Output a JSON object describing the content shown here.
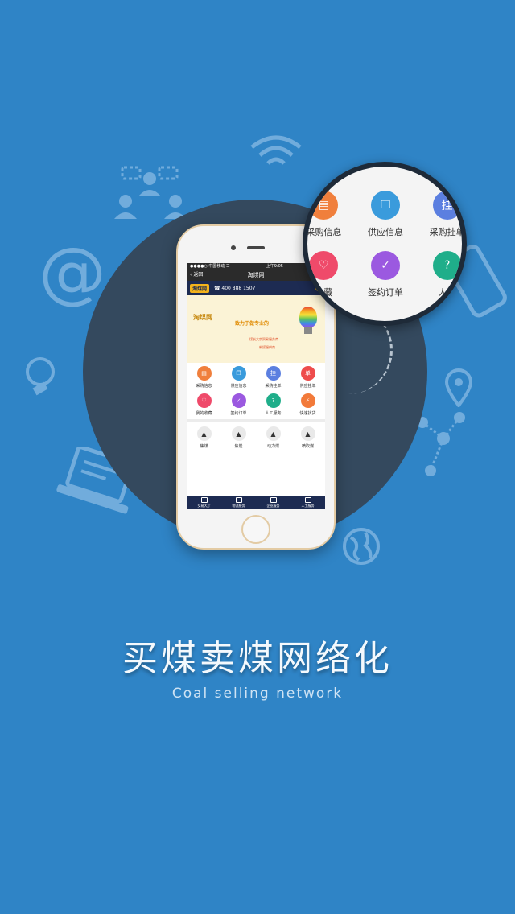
{
  "colors": {
    "background": "#2f84c6",
    "circle": "#34495e",
    "navy": "#1d2b52"
  },
  "decor_icons": [
    "people-icon",
    "wifi-icon",
    "at-icon",
    "lightbulb-icon",
    "laptop-icon",
    "phone-icon",
    "location-icon",
    "network-icon",
    "globe-icon"
  ],
  "phone": {
    "status_left": "●●●●○ 中国移动 ☰",
    "status_time": "上午9:05",
    "nav_back": "返回",
    "nav_title": "淘煤网",
    "brand_logo": "淘煤网",
    "hotline": "☎ 400 888 1507",
    "banner": {
      "logo": "淘煤网",
      "slogan": "致力于做专业的",
      "line1": "煤炭大宗贸易服务商",
      "line2": "新媒服供商"
    },
    "grid": [
      {
        "label": "采购信息",
        "glyph": "▤",
        "color": "#f07f3c",
        "icon": "document-icon"
      },
      {
        "label": "供应信息",
        "glyph": "❐",
        "color": "#3a9bdc",
        "icon": "copy-icon"
      },
      {
        "label": "采购挂单",
        "glyph": "挂",
        "color": "#5b7fe0",
        "icon": "hang-order-icon"
      },
      {
        "label": "供应挂单",
        "glyph": "单",
        "color": "#ee4c4c",
        "icon": "order-icon"
      },
      {
        "label": "我的收藏",
        "glyph": "♡",
        "color": "#ef4a6a",
        "icon": "heart-icon"
      },
      {
        "label": "签约订单",
        "glyph": "✓",
        "color": "#9b59e0",
        "icon": "check-icon"
      },
      {
        "label": "人工服务",
        "glyph": "?",
        "color": "#1fae8a",
        "icon": "help-icon"
      },
      {
        "label": "快速找货",
        "glyph": "⚡",
        "color": "#f27a3a",
        "icon": "bolt-icon"
      }
    ],
    "coal": [
      "焦煤",
      "焦炭",
      "动力煤",
      "喷吹煤"
    ],
    "tabs": [
      "交易大厅",
      "物流服务",
      "企业服务",
      "人工服务"
    ]
  },
  "magnifier": [
    {
      "label": "采购信息",
      "glyph": "▤",
      "color": "#f07f3c",
      "icon": "document-icon"
    },
    {
      "label": "供应信息",
      "glyph": "❐",
      "color": "#3a9bdc",
      "icon": "copy-icon"
    },
    {
      "label": "采购挂单",
      "glyph": "挂",
      "color": "#5b7fe0",
      "icon": "hang-order-icon"
    },
    {
      "label": "收藏",
      "glyph": "♡",
      "color": "#ef4a6a",
      "icon": "heart-icon"
    },
    {
      "label": "签约订单",
      "glyph": "✓",
      "color": "#9b59e0",
      "icon": "check-icon"
    },
    {
      "label": "人工",
      "glyph": "?",
      "color": "#1fae8a",
      "icon": "help-icon"
    }
  ],
  "headline": "买煤卖煤网络化",
  "subline": "Coal selling network"
}
